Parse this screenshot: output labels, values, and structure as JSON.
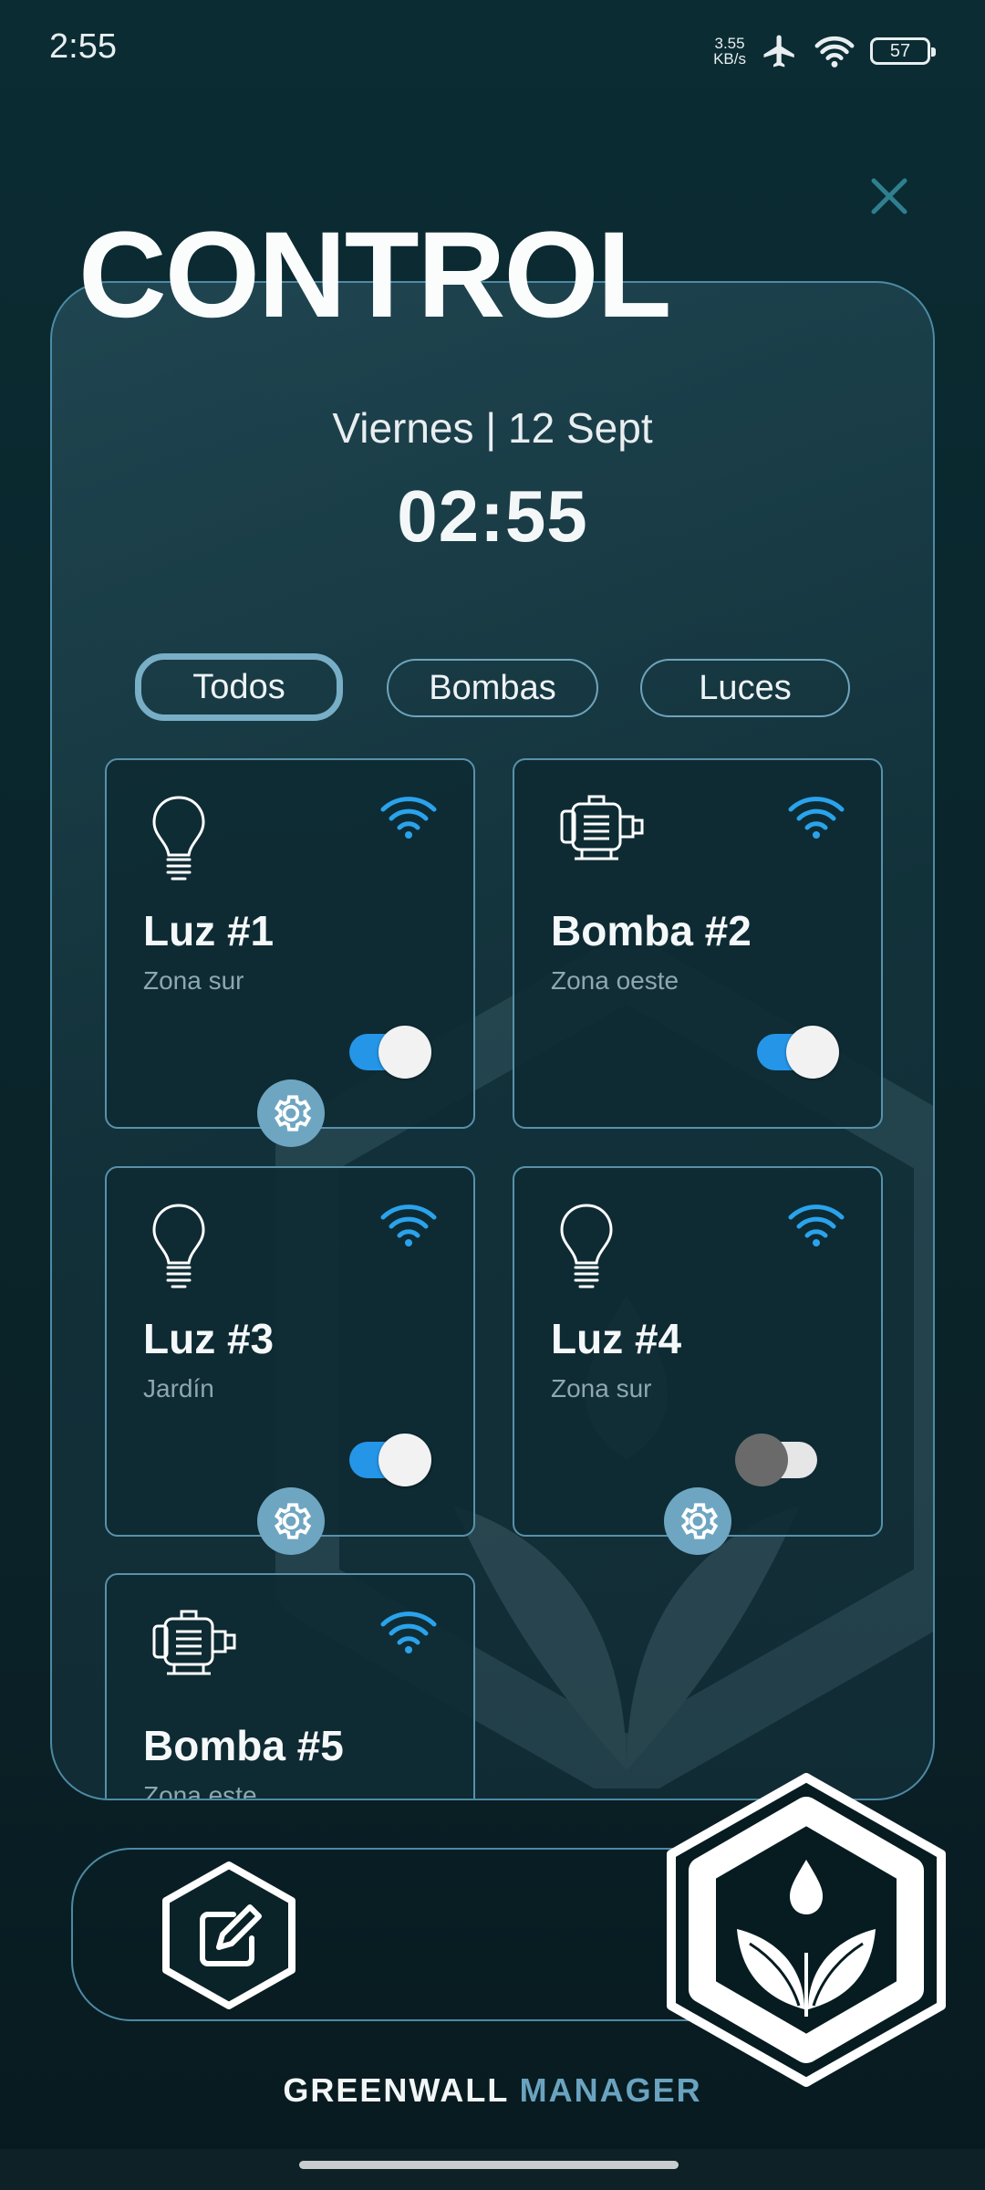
{
  "status_bar": {
    "time": "2:55",
    "net_speed_value": "3.55",
    "net_speed_unit": "KB/s",
    "battery": "57",
    "icons": [
      "airplane-icon",
      "wifi-icon",
      "battery-icon"
    ]
  },
  "header": {
    "title": "CONTROL",
    "close_icon": "close-icon"
  },
  "datetime": {
    "date": "Viernes | 12 Sept",
    "time": "02:55"
  },
  "filters": [
    {
      "label": "Todos",
      "active": true
    },
    {
      "label": "Bombas",
      "active": false
    },
    {
      "label": "Luces",
      "active": false
    }
  ],
  "devices": [
    {
      "name": "Luz #1",
      "zone": "Zona sur",
      "type": "bulb",
      "on": true,
      "settings": true
    },
    {
      "name": "Bomba #2",
      "zone": "Zona oeste",
      "type": "pump",
      "on": true,
      "settings": false
    },
    {
      "name": "Luz #3",
      "zone": "Jardín",
      "type": "bulb",
      "on": true,
      "settings": true
    },
    {
      "name": "Luz #4",
      "zone": "Zona sur",
      "type": "bulb",
      "on": false,
      "settings": true
    },
    {
      "name": "Bomba #5",
      "zone": "Zona este",
      "type": "pump",
      "on": null,
      "settings": false
    }
  ],
  "bottom_bar": {
    "edit_icon": "edit-icon",
    "logo_icon": "plant-drop-logo-icon"
  },
  "brand": {
    "part1": "GREENWALL",
    "part2": "MANAGER"
  },
  "colors": {
    "accent": "#2595e8",
    "border": "#4d8aa4",
    "brand_blue": "#6aa3c0",
    "background": "#0b2c33"
  }
}
